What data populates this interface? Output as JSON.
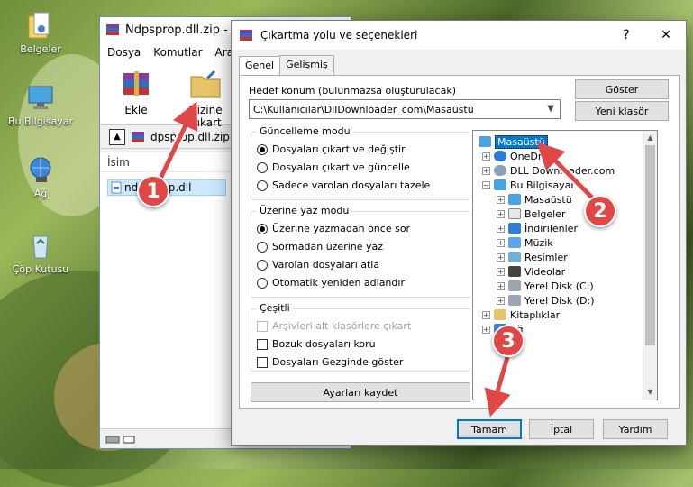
{
  "desktop": {
    "icons": [
      {
        "label": "Belgeler",
        "icon": "folder-documents-icon"
      },
      {
        "label": "Bu Bilgisayar",
        "icon": "computer-icon"
      },
      {
        "label": "Ağ",
        "icon": "network-icon"
      },
      {
        "label": "Çöp Kutusu",
        "icon": "recycle-bin-icon"
      }
    ]
  },
  "winrar": {
    "title": "Ndpsprop.dll.zip - W",
    "menu": [
      "Dosya",
      "Komutlar",
      "Araçla"
    ],
    "toolbar": {
      "extract_label": "Ekle",
      "extract_to_label": "Dizine Çıkart"
    },
    "address": "dpsprop.dll.zip",
    "list_header": "İsim",
    "file_row": "ndpsprop.dll"
  },
  "dialog": {
    "title": "Çıkartma yolu ve seçenekleri",
    "title_buttons": {
      "help": "?",
      "close": "✕"
    },
    "tabs": [
      {
        "label": "Genel",
        "active": true
      },
      {
        "label": "Gelişmiş",
        "active": false
      }
    ],
    "destination_label": "Hedef konum (bulunmazsa oluşturulacak)",
    "destination_value": "C:\\Kullanıcılar\\DllDownloader_com\\Masaüstü",
    "show_button": "Göster",
    "new_folder_button": "Yeni klasör",
    "update_mode": {
      "title": "Güncelleme modu",
      "options": [
        {
          "label": "Dosyaları çıkart ve değiştir",
          "selected": true
        },
        {
          "label": "Dosyaları çıkart ve güncelle",
          "selected": false
        },
        {
          "label": "Sadece varolan dosyaları tazele",
          "selected": false
        }
      ]
    },
    "overwrite_mode": {
      "title": "Üzerine yaz modu",
      "options": [
        {
          "label": "Üzerine yazmadan önce sor",
          "selected": true
        },
        {
          "label": "Sormadan üzerine yaz",
          "selected": false
        },
        {
          "label": "Varolan dosyaları atla",
          "selected": false
        },
        {
          "label": "Otomatik yeniden adlandır",
          "selected": false
        }
      ]
    },
    "misc": {
      "title": "Çeşitli",
      "options": [
        {
          "label": "Arşivleri alt klasörlere çıkart",
          "checked": false,
          "disabled": true
        },
        {
          "label": "Bozuk dosyaları koru",
          "checked": false,
          "disabled": false
        },
        {
          "label": "Dosyaları Gezginde göster",
          "checked": false,
          "disabled": false
        }
      ]
    },
    "save_settings_button": "Ayarları kaydet",
    "tree": [
      {
        "label": "Masaüstü",
        "icon": "desktop-icon",
        "selected": true
      },
      {
        "label": "OneDrive",
        "icon": "onedrive-icon"
      },
      {
        "label": "DLL Downloader.com",
        "icon": "user-icon"
      },
      {
        "label": "Bu Bilgisayar",
        "icon": "computer-icon"
      },
      {
        "label": "Masaüstü",
        "icon": "desktop-icon"
      },
      {
        "label": "Belgeler",
        "icon": "documents-icon"
      },
      {
        "label": "İndirilenler",
        "icon": "downloads-icon"
      },
      {
        "label": "Müzik",
        "icon": "music-icon"
      },
      {
        "label": "Resimler",
        "icon": "pictures-icon"
      },
      {
        "label": "Videolar",
        "icon": "videos-icon"
      },
      {
        "label": "Yerel Disk (C:)",
        "icon": "drive-icon"
      },
      {
        "label": "Yerel Disk (D:)",
        "icon": "drive-icon"
      },
      {
        "label": "Kitaplıklar",
        "icon": "libraries-icon"
      },
      {
        "label": "Ağ",
        "icon": "network-icon"
      }
    ],
    "ok_button": "Tamam",
    "cancel_button": "İptal",
    "help_button": "Yardım"
  },
  "annotations": [
    "1",
    "2",
    "3"
  ],
  "colors": {
    "annotation": "#e04848",
    "selection": "#0078d7"
  }
}
